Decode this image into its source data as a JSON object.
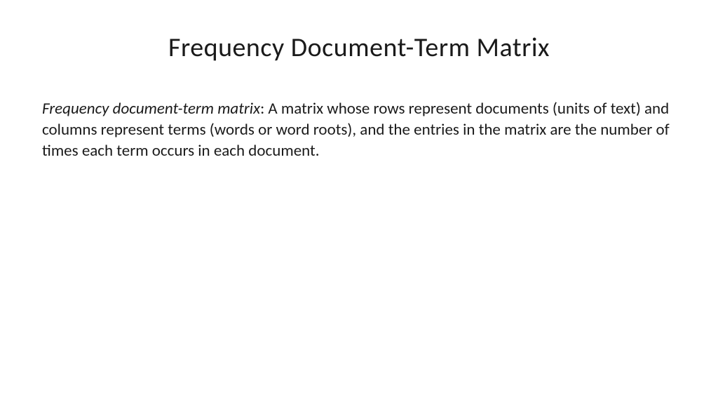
{
  "title": "Frequency Document-Term Matrix",
  "definition": {
    "term": "Frequency document-term matrix",
    "description": ": A matrix whose rows represent documents (units of text) and columns represent terms (words or word roots), and the entries in the matrix are the number of times each term occurs in each document."
  }
}
